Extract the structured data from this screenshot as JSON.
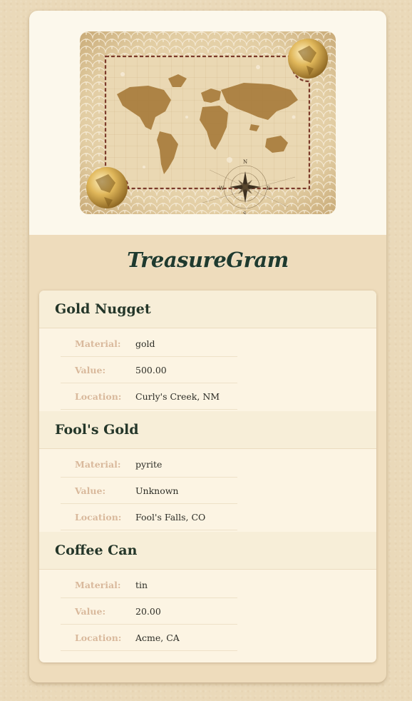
{
  "app": {
    "title": "TreasureGram"
  },
  "banner": {
    "image": "vintage-world-map-with-globes-and-compass",
    "compass_letters": [
      "N",
      "E",
      "S",
      "W"
    ]
  },
  "treasures": [
    {
      "name": "Gold Nugget",
      "fields": [
        {
          "label": "Material:",
          "value": "gold"
        },
        {
          "label": "Value:",
          "value": "500.00"
        },
        {
          "label": "Location:",
          "value": "Curly's Creek, NM"
        }
      ]
    },
    {
      "name": "Fool's Gold",
      "fields": [
        {
          "label": "Material:",
          "value": "pyrite"
        },
        {
          "label": "Value:",
          "value": "Unknown"
        },
        {
          "label": "Location:",
          "value": "Fool's Falls, CO"
        }
      ]
    },
    {
      "name": "Coffee Can",
      "fields": [
        {
          "label": "Material:",
          "value": "tin"
        },
        {
          "label": "Value:",
          "value": "20.00"
        },
        {
          "label": "Location:",
          "value": "Acme, CA"
        }
      ]
    }
  ],
  "colors": {
    "page_bg": "#ead9b9",
    "title": "#1f3a2e",
    "label": "#d9b99c",
    "value": "#2d2d26",
    "header_bg": "#f7eed8"
  }
}
